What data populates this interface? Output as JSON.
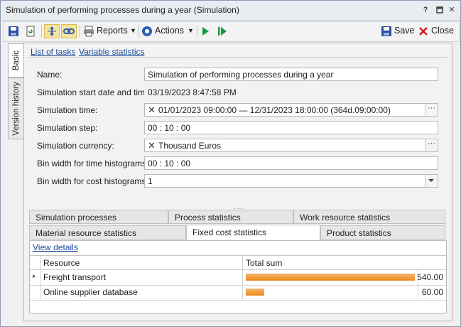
{
  "window": {
    "title": "Simulation of performing processes during a year (Simulation)",
    "controls": {
      "help": "?",
      "restore": "▫",
      "close": "✕"
    }
  },
  "toolbar": {
    "reports_label": "Reports",
    "actions_label": "Actions",
    "save_label": "Save",
    "close_label": "Close"
  },
  "side_tabs": [
    "Basic",
    "Version history"
  ],
  "links": {
    "list_of_tasks": "List of tasks",
    "variable_statistics": "Variable statistics"
  },
  "form": {
    "name_label": "Name:",
    "name_value": "Simulation of performing processes during a year",
    "start_label": "Simulation start date and time:",
    "start_value": "03/19/2023 8:47:58 PM",
    "time_label": "Simulation time:",
    "time_value": "01/01/2023 09:00:00 — 12/31/2023 18:00:00 (364d.09:00:00)",
    "step_label": "Simulation step:",
    "step_value": "00 : 10 : 00",
    "currency_label": "Simulation currency:",
    "currency_value": "Thousand Euros",
    "bin_time_label": "Bin width for time histograms:",
    "bin_time_value": "00 : 10 : 00",
    "bin_cost_label": "Bin width for cost histograms:",
    "bin_cost_value": "1"
  },
  "splitter": "....",
  "tabs_row1": [
    "Simulation processes",
    "Process statistics",
    "Work resource statistics"
  ],
  "tabs_row2": [
    "Material resource statistics",
    "Fixed cost statistics",
    "Product statistics"
  ],
  "active_tab": "Fixed cost statistics",
  "panel": {
    "view_details": "View details",
    "columns": [
      "Resource",
      "Total sum"
    ],
    "rows": [
      {
        "resource": "Freight transport",
        "total": "540.00",
        "fraction": 1.0
      },
      {
        "resource": "Online supplier database",
        "total": "60.00",
        "fraction": 0.111
      }
    ]
  },
  "colors": {
    "bar": "#f08a1a",
    "link": "#1a4a9a",
    "accent_play": "#1a9a3a"
  }
}
